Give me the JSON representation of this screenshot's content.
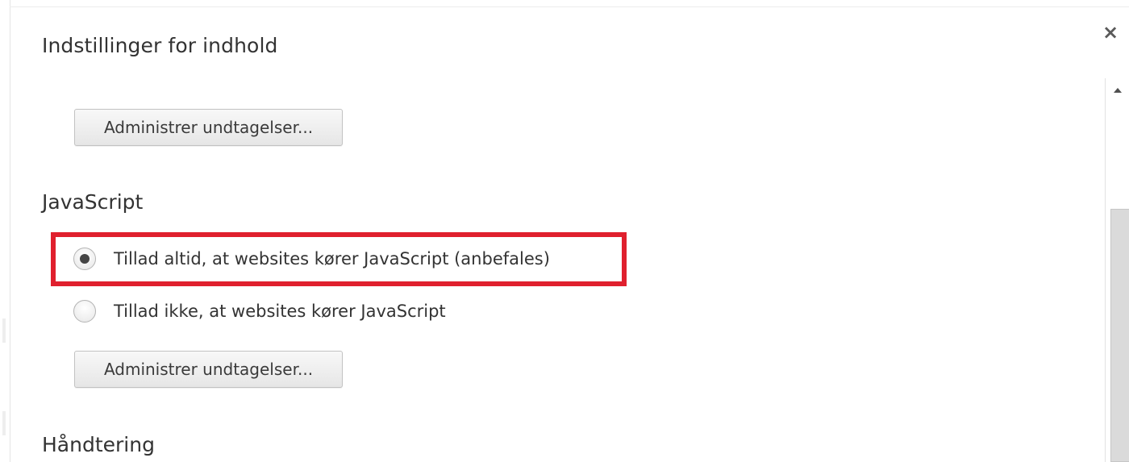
{
  "dialog": {
    "title": "Indstillinger for indhold",
    "close_label": "×"
  },
  "top_section": {
    "manage_exceptions_label": "Administrer undtagelser..."
  },
  "javascript_section": {
    "heading": "JavaScript",
    "options": [
      {
        "label": "Tillad altid, at websites kører JavaScript (anbefales)",
        "selected": true
      },
      {
        "label": "Tillad ikke, at websites kører JavaScript",
        "selected": false
      }
    ],
    "manage_exceptions_label": "Administrer undtagelser..."
  },
  "next_section": {
    "heading": "Håndtering"
  },
  "colors": {
    "highlight": "#e0202e",
    "radio_dot": "#444444"
  }
}
